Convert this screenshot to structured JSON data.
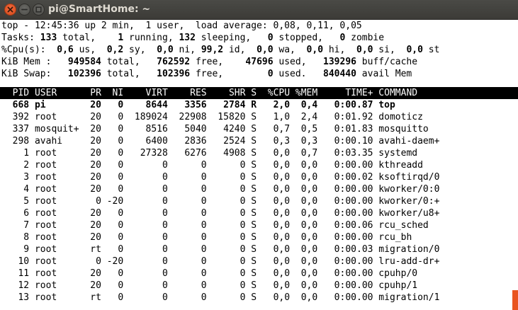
{
  "window": {
    "title": "pi@SmartHome: ~"
  },
  "summary": {
    "l1": "top - 12:45:36 up 2 min,  1 user,  load average: 0,08, 0,11, 0,05",
    "tasks": {
      "p0": "Tasks: ",
      "total": "133",
      "p1": " total,    ",
      "running": "1",
      "p2": " running, ",
      "sleeping": "132",
      "p3": " sleeping,   ",
      "stopped": "0",
      "p4": " stopped,   ",
      "zombie": "0",
      "p5": " zombie"
    },
    "cpu": {
      "p0": "%Cpu(s):  ",
      "us": "0,6",
      "p1": " us,  ",
      "sy": "0,2",
      "p2": " sy,  ",
      "ni": "0,0",
      "p3": " ni, ",
      "id": "99,2",
      "p4": " id,  ",
      "wa": "0,0",
      "p5": " wa,  ",
      "hi": "0,0",
      "p6": " hi,  ",
      "si": "0,0",
      "p7": " si,  ",
      "st": "0,0",
      "p8": " st"
    },
    "mem": {
      "p0": "KiB Mem :   ",
      "total": "949584",
      "p1": " total,   ",
      "free": "762592",
      "p2": " free,    ",
      "used": "47696",
      "p3": " used,   ",
      "buff": "139296",
      "p4": " buff/cache"
    },
    "swap": {
      "p0": "KiB Swap:   ",
      "total": "102396",
      "p1": " total,   ",
      "free": "102396",
      "p2": " free,        ",
      "used": "0",
      "p3": " used.   ",
      "avail": "840440",
      "p4": " avail Mem"
    }
  },
  "columns": [
    "PID",
    "USER",
    "PR",
    "NI",
    "VIRT",
    "RES",
    "SHR",
    "S",
    "%CPU",
    "%MEM",
    "TIME+",
    "COMMAND"
  ],
  "processes": [
    {
      "pid": "668",
      "user": "pi",
      "pr": "20",
      "ni": "0",
      "virt": "8644",
      "res": "3356",
      "shr": "2784",
      "s": "R",
      "cpu": "2,0",
      "mem": "0,4",
      "time": "0:00.87",
      "command": "top",
      "bold": true
    },
    {
      "pid": "392",
      "user": "root",
      "pr": "20",
      "ni": "0",
      "virt": "189024",
      "res": "22908",
      "shr": "15820",
      "s": "S",
      "cpu": "1,0",
      "mem": "2,4",
      "time": "0:01.92",
      "command": "domoticz"
    },
    {
      "pid": "337",
      "user": "mosquit+",
      "pr": "20",
      "ni": "0",
      "virt": "8516",
      "res": "5040",
      "shr": "4240",
      "s": "S",
      "cpu": "0,7",
      "mem": "0,5",
      "time": "0:01.83",
      "command": "mosquitto"
    },
    {
      "pid": "298",
      "user": "avahi",
      "pr": "20",
      "ni": "0",
      "virt": "6400",
      "res": "2836",
      "shr": "2524",
      "s": "S",
      "cpu": "0,3",
      "mem": "0,3",
      "time": "0:00.10",
      "command": "avahi-daem+"
    },
    {
      "pid": "1",
      "user": "root",
      "pr": "20",
      "ni": "0",
      "virt": "27328",
      "res": "6276",
      "shr": "4908",
      "s": "S",
      "cpu": "0,0",
      "mem": "0,7",
      "time": "0:03.35",
      "command": "systemd"
    },
    {
      "pid": "2",
      "user": "root",
      "pr": "20",
      "ni": "0",
      "virt": "0",
      "res": "0",
      "shr": "0",
      "s": "S",
      "cpu": "0,0",
      "mem": "0,0",
      "time": "0:00.00",
      "command": "kthreadd"
    },
    {
      "pid": "3",
      "user": "root",
      "pr": "20",
      "ni": "0",
      "virt": "0",
      "res": "0",
      "shr": "0",
      "s": "S",
      "cpu": "0,0",
      "mem": "0,0",
      "time": "0:00.02",
      "command": "ksoftirqd/0"
    },
    {
      "pid": "4",
      "user": "root",
      "pr": "20",
      "ni": "0",
      "virt": "0",
      "res": "0",
      "shr": "0",
      "s": "S",
      "cpu": "0,0",
      "mem": "0,0",
      "time": "0:00.00",
      "command": "kworker/0:0"
    },
    {
      "pid": "5",
      "user": "root",
      "pr": "0",
      "ni": "-20",
      "virt": "0",
      "res": "0",
      "shr": "0",
      "s": "S",
      "cpu": "0,0",
      "mem": "0,0",
      "time": "0:00.00",
      "command": "kworker/0:+"
    },
    {
      "pid": "6",
      "user": "root",
      "pr": "20",
      "ni": "0",
      "virt": "0",
      "res": "0",
      "shr": "0",
      "s": "S",
      "cpu": "0,0",
      "mem": "0,0",
      "time": "0:00.00",
      "command": "kworker/u8+"
    },
    {
      "pid": "7",
      "user": "root",
      "pr": "20",
      "ni": "0",
      "virt": "0",
      "res": "0",
      "shr": "0",
      "s": "S",
      "cpu": "0,0",
      "mem": "0,0",
      "time": "0:00.06",
      "command": "rcu_sched"
    },
    {
      "pid": "8",
      "user": "root",
      "pr": "20",
      "ni": "0",
      "virt": "0",
      "res": "0",
      "shr": "0",
      "s": "S",
      "cpu": "0,0",
      "mem": "0,0",
      "time": "0:00.00",
      "command": "rcu_bh"
    },
    {
      "pid": "9",
      "user": "root",
      "pr": "rt",
      "ni": "0",
      "virt": "0",
      "res": "0",
      "shr": "0",
      "s": "S",
      "cpu": "0,0",
      "mem": "0,0",
      "time": "0:00.03",
      "command": "migration/0"
    },
    {
      "pid": "10",
      "user": "root",
      "pr": "0",
      "ni": "-20",
      "virt": "0",
      "res": "0",
      "shr": "0",
      "s": "S",
      "cpu": "0,0",
      "mem": "0,0",
      "time": "0:00.00",
      "command": "lru-add-dr+"
    },
    {
      "pid": "11",
      "user": "root",
      "pr": "20",
      "ni": "0",
      "virt": "0",
      "res": "0",
      "shr": "0",
      "s": "S",
      "cpu": "0,0",
      "mem": "0,0",
      "time": "0:00.00",
      "command": "cpuhp/0"
    },
    {
      "pid": "12",
      "user": "root",
      "pr": "20",
      "ni": "0",
      "virt": "0",
      "res": "0",
      "shr": "0",
      "s": "S",
      "cpu": "0,0",
      "mem": "0,0",
      "time": "0:00.00",
      "command": "cpuhp/1"
    },
    {
      "pid": "13",
      "user": "root",
      "pr": "rt",
      "ni": "0",
      "virt": "0",
      "res": "0",
      "shr": "0",
      "s": "S",
      "cpu": "0,0",
      "mem": "0,0",
      "time": "0:00.00",
      "command": "migration/1"
    }
  ],
  "colors": {
    "titlebar": "#3c3b37",
    "close_button": "#e95420",
    "terminal_bg": "#ffffff",
    "terminal_fg": "#000000",
    "header_bg": "#000000",
    "header_fg": "#ffffff"
  },
  "icons": {
    "close": "close-icon",
    "minimize": "minimize-icon",
    "maximize": "maximize-icon"
  }
}
